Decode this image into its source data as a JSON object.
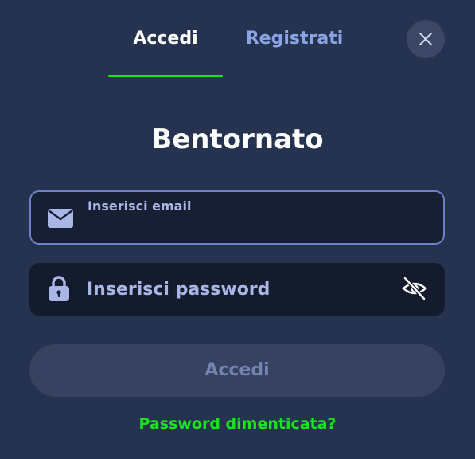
{
  "tabs": {
    "login_label": "Accedi",
    "register_label": "Registrati"
  },
  "title": "Bentornato",
  "email_field": {
    "label": "Inserisci email",
    "value": ""
  },
  "password_field": {
    "placeholder": "Inserisci password",
    "value": ""
  },
  "submit_button": {
    "label": "Accedi"
  },
  "forgot_password_link": "Password dimenticata?",
  "icons": {
    "close": "close-icon",
    "email": "envelope-icon",
    "password": "lock-icon",
    "visibility": "eye-off-icon"
  },
  "colors": {
    "background": "#253250",
    "accent_green": "#19e619",
    "active_tab_text": "#ffffff",
    "inactive_tab_text": "#8aa4e6",
    "focused_field_border": "#6e80c8",
    "button_bg": "#36425f"
  }
}
